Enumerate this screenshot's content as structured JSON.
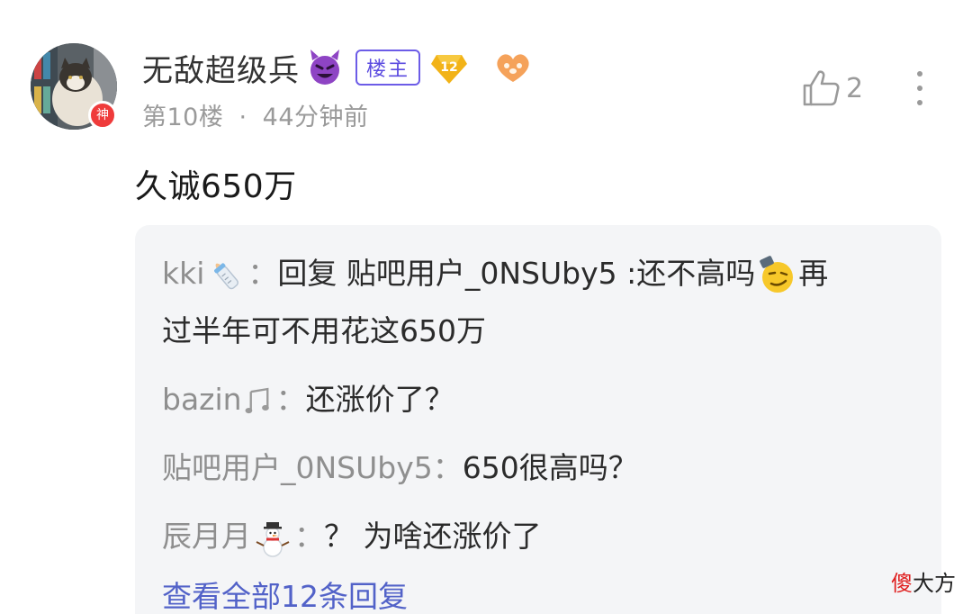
{
  "post": {
    "author": {
      "name": "无敌超级兵",
      "avatar_badge": "神",
      "op_badge": "楼主",
      "level": "12"
    },
    "floor": "第10楼",
    "separator": "·",
    "time": "44分钟前",
    "likes": "2",
    "content": "久诚650万"
  },
  "replies": [
    {
      "author": "kki",
      "author_emoji": "baby-bottle",
      "colon": "：",
      "line1": "回复 贴吧用户_0NSUby5 :还不高吗",
      "line1_tail": "再",
      "line2": "过半年可不用花这650万"
    },
    {
      "author": "bazin",
      "author_emoji": "music-note",
      "colon": "：",
      "text": "还涨价了？"
    },
    {
      "author": "贴吧用户_0NSUby5",
      "colon": "：",
      "text": "650很高吗？"
    },
    {
      "author": "辰月月",
      "author_emoji": "snowman",
      "colon": "：",
      "text": "？ 为啥还涨价了"
    }
  ],
  "view_all": "查看全部12条回复",
  "watermark": {
    "red_part": "傻",
    "black_part": "大方"
  },
  "colors": {
    "accent": "#5262c8",
    "op_badge": "#5b4be0",
    "meta": "#9a9a9a",
    "reply_bg": "#f4f5f7",
    "god_badge": "#ef3b3b"
  }
}
